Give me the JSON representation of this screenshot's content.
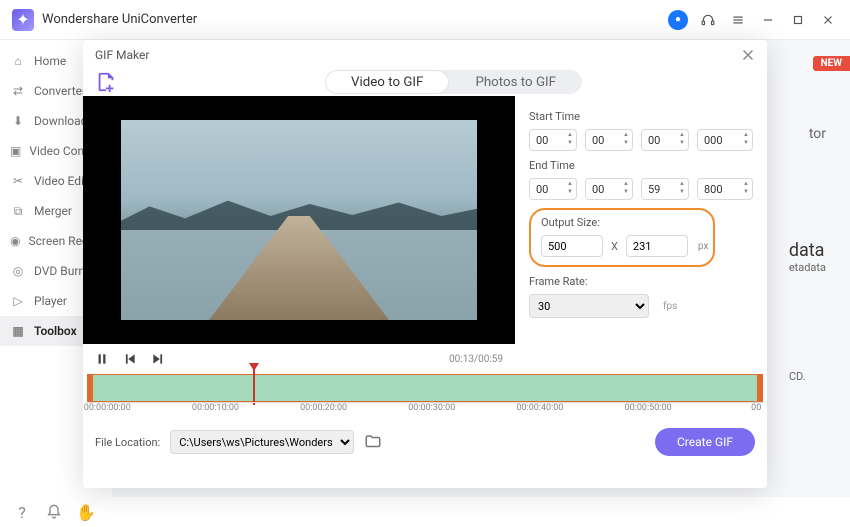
{
  "app": {
    "title": "Wondershare UniConverter"
  },
  "sidebar": {
    "items": [
      {
        "label": "Home"
      },
      {
        "label": "Converter"
      },
      {
        "label": "Downloader"
      },
      {
        "label": "Video Compressor"
      },
      {
        "label": "Video Editor"
      },
      {
        "label": "Merger"
      },
      {
        "label": "Screen Recorder"
      },
      {
        "label": "DVD Burner"
      },
      {
        "label": "Player"
      },
      {
        "label": "Toolbox"
      }
    ]
  },
  "new_badge": "NEW",
  "bg": {
    "tor": "tor",
    "data": "data",
    "etadata": "etadata",
    "cd": "CD."
  },
  "modal": {
    "title": "GIF Maker",
    "tabs": {
      "video": "Video to GIF",
      "photos": "Photos to GIF"
    },
    "time_display": "00:13/00:59",
    "start_label": "Start Time",
    "end_label": "End Time",
    "output_label": "Output Size:",
    "framerate_label": "Frame Rate:",
    "start": {
      "h": "00",
      "m": "00",
      "s": "00",
      "ms": "000"
    },
    "end": {
      "h": "00",
      "m": "00",
      "s": "59",
      "ms": "800"
    },
    "output": {
      "w": "500",
      "h": "231",
      "x": "X",
      "unit": "px"
    },
    "framerate": "30",
    "fps_label": "fps",
    "ruler": [
      "00:00:00:00",
      "00:00:10:00",
      "00:00:20:00",
      "00:00:30:00",
      "00:00:40:00",
      "00:00:50:00",
      "00"
    ],
    "file_label": "File Location:",
    "file_path": "C:\\Users\\ws\\Pictures\\Wonders",
    "create_label": "Create GIF"
  }
}
